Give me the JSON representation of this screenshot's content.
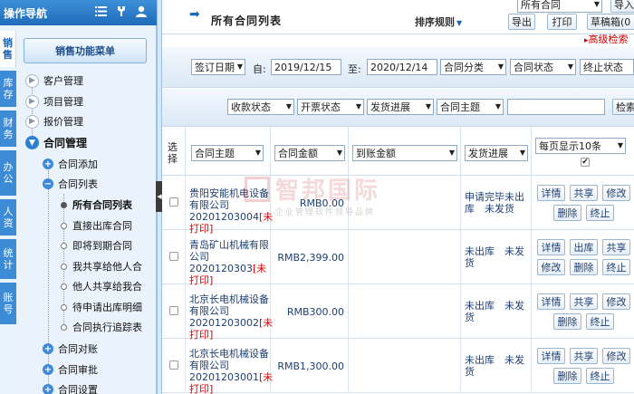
{
  "sidebar": {
    "title": "操作导航",
    "menu_button": "销售功能菜单",
    "vtabs": [
      "销售",
      "库存",
      "财务",
      "办公",
      "人资",
      "统计",
      "账号"
    ],
    "items": [
      {
        "label": "客户管理"
      },
      {
        "label": "项目管理"
      },
      {
        "label": "报价管理"
      },
      {
        "label": "合同管理"
      },
      {
        "label": "合同添加"
      },
      {
        "label": "合同列表"
      },
      {
        "label": "所有合同列表",
        "selected": true
      },
      {
        "label": "直接出库合同"
      },
      {
        "label": "即将到期合同"
      },
      {
        "label": "我共享给他人合"
      },
      {
        "label": "他人共享给我合"
      },
      {
        "label": "待申请出库明细"
      },
      {
        "label": "合同执行追踪表"
      },
      {
        "label": "合同对账"
      },
      {
        "label": "合同审批"
      },
      {
        "label": "合同设置"
      }
    ]
  },
  "header": {
    "title": "所有合同列表",
    "sort_rule": "排序规则",
    "scope_select": "所有合同",
    "import_btn": "导入",
    "export_btn": "导出",
    "print_btn": "打印",
    "recycle_btn": "草稿箱(0",
    "advanced_search": "高级检索"
  },
  "filters": {
    "date_type": "签订日期",
    "from_label": "自:",
    "from_value": "2019/12/15",
    "to_label": "至:",
    "to_value": "2020/12/14",
    "category": "合同分类",
    "status": "合同状态",
    "terminated": "终止状态",
    "payment_status": "收款状态",
    "invoice_status": "开票状态",
    "shipping_progress": "发货进展",
    "subject": "合同主题",
    "search_btn": "检索"
  },
  "table": {
    "col_select": "选择",
    "col_subject": "合同主题",
    "col_amount": "合同金额",
    "col_received": "到账金额",
    "col_shipping": "发货进展",
    "page_size": "每页显示10条",
    "rows": [
      {
        "subject": "贵阳安能机电设备有限公司20201203004",
        "status": "[未打印]",
        "amount": "RMB0.00",
        "received": "",
        "shipping": "申请完毕未出库　未发货",
        "actions": [
          "详情",
          "共享",
          "修改",
          "删除",
          "终止"
        ]
      },
      {
        "subject": "青岛矿山机械有限公司2020120303",
        "status": "[未打印]",
        "amount": "RMB2,399.00",
        "received": "",
        "shipping": "未出库　未发货",
        "actions": [
          "详情",
          "出库",
          "共享",
          "修改",
          "删除",
          "终止"
        ]
      },
      {
        "subject": "北京长电机械设备有限公司20201203002",
        "status": "[未打印]",
        "amount": "RMB300.00",
        "received": "",
        "shipping": "未出库　未发货",
        "actions": [
          "详情",
          "共享",
          "修改",
          "删除",
          "终止"
        ]
      },
      {
        "subject": "北京长电机械设备有限公司20201203001",
        "status": "[未打印]",
        "amount": "RMB1,300.00",
        "received": "",
        "shipping": "未出库　未发货",
        "actions": [
          "详情",
          "共享",
          "修改",
          "删除",
          "终止"
        ]
      }
    ]
  },
  "watermark": {
    "big": "智邦国际",
    "small": "企业管理软件领导品牌"
  },
  "colors": {
    "nav_blue": "#1f6cba",
    "accent": "#3b8bd6",
    "status_red": "#dd0000"
  }
}
